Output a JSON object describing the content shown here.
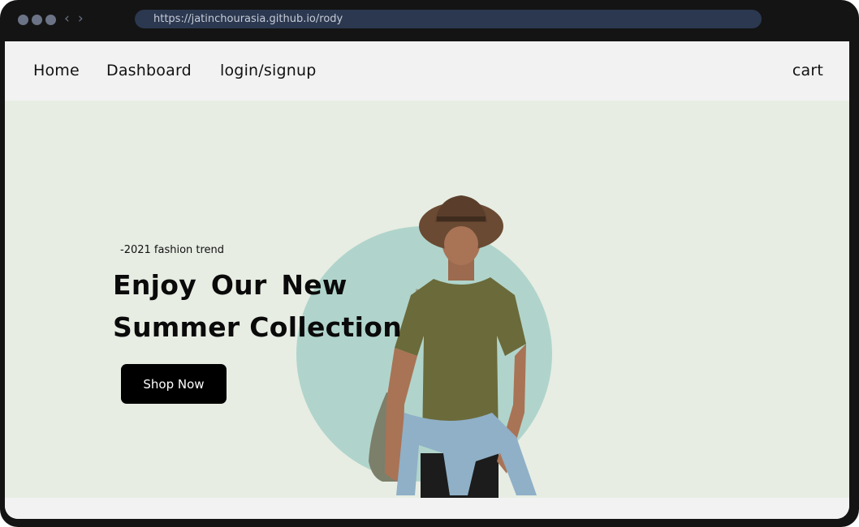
{
  "browser": {
    "url": "https://jatinchourasia.github.io/rody",
    "back_glyph": "‹",
    "forward_glyph": "›"
  },
  "navbar": {
    "home": "Home",
    "dashboard": "Dashboard",
    "login": "login/signup",
    "cart": "cart"
  },
  "hero": {
    "subtitle": "-2021 fashion trend",
    "title_line1": "Enjoy Our New",
    "title_line2": "Summer Collection",
    "cta": "Shop Now",
    "image": "model-with-hat-and-backpack"
  },
  "colors": {
    "hero_bg": "#e7ede3",
    "circle": "#b0d4cb",
    "button": "#000000",
    "shirt": "#6b6a3a",
    "hat": "#6a4a33"
  }
}
